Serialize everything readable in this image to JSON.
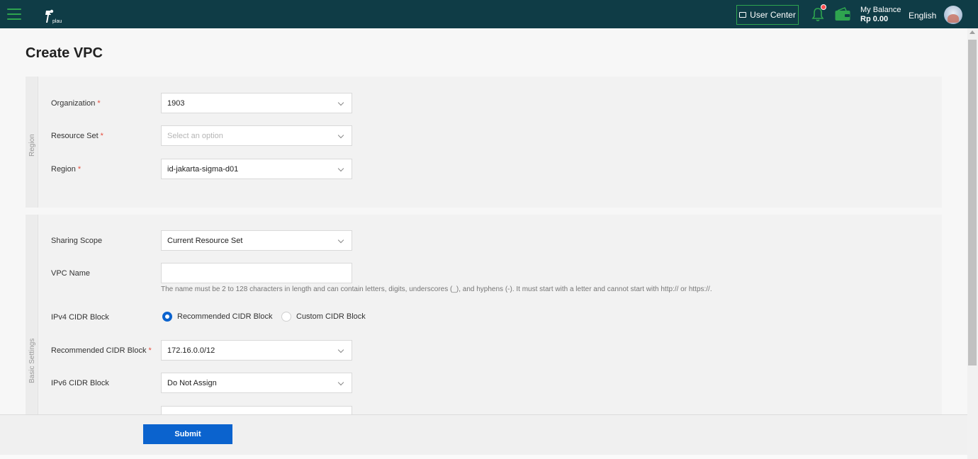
{
  "header": {
    "user_center_label": "User Center",
    "balance_label": "My Balance",
    "balance_amount": "Rp 0.00",
    "language": "English",
    "logo_text": "plau",
    "accent_color": "#2ea44f"
  },
  "page": {
    "title": "Create VPC"
  },
  "region_section": {
    "side_label": "Region",
    "organization": {
      "label": "Organization",
      "value": "1903"
    },
    "resource_set": {
      "label": "Resource Set",
      "placeholder": "Select an option"
    },
    "region": {
      "label": "Region",
      "value": "id-jakarta-sigma-d01"
    }
  },
  "basic_section": {
    "side_label": "Basic Settings",
    "sharing_scope": {
      "label": "Sharing Scope",
      "value": "Current Resource Set"
    },
    "vpc_name": {
      "label": "VPC Name",
      "value": "",
      "hint": "The name must be 2 to 128 characters in length and can contain letters, digits, underscores (_), and hyphens (-). It must start with a letter and cannot start with http:// or https://."
    },
    "ipv4": {
      "label": "IPv4 CIDR Block",
      "option_recommended": "Recommended CIDR Block",
      "option_custom": "Custom CIDR Block"
    },
    "recommended_cidr": {
      "label": "Recommended CIDR Block",
      "value": "172.16.0.0/12"
    },
    "ipv6": {
      "label": "IPv6 CIDR Block",
      "value": "Do Not Assign"
    }
  },
  "footer": {
    "submit_label": "Submit"
  }
}
